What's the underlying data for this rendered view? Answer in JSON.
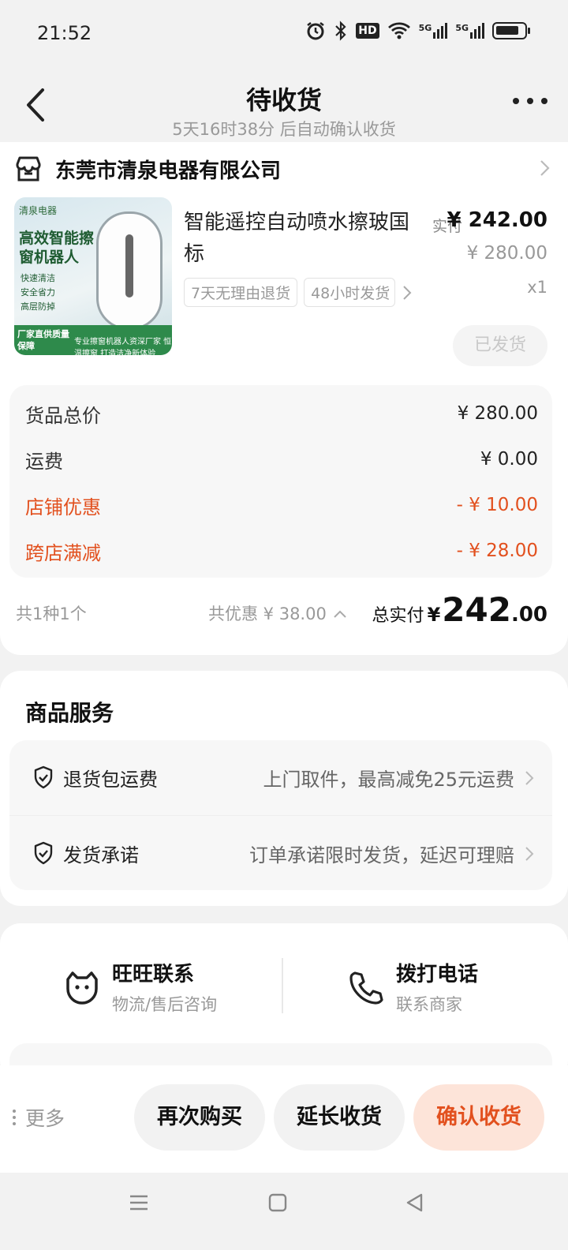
{
  "status_bar": {
    "time": "21:52",
    "hd_label": "HD",
    "net1": "5G",
    "net2": "5G"
  },
  "nav": {
    "title": "待收货",
    "subtitle": "5天16时38分 后自动确认收货"
  },
  "order": {
    "shop_name": "东莞市清泉电器有限公司",
    "product": {
      "thumb_brand": "清泉电器",
      "thumb_title": "高效智能擦窗机器人",
      "thumb_checks": [
        "快速清洁",
        "安全省力",
        "高层防掉"
      ],
      "thumb_badge": "厂家直供质量保障",
      "thumb_sub": "专业擦窗机器人资深厂家 恒温擦窗 打造洁净新体验",
      "title": "智能遥控自动喷水擦玻国标",
      "paid_label": "实付",
      "paid_price": "¥ 242.00",
      "original_price": "¥ 280.00",
      "quantity": "x1",
      "tags": [
        "7天无理由退货",
        "48小时发货"
      ],
      "status_button": "已发货"
    },
    "price_rows": [
      {
        "label": "货品总价",
        "value": "¥ 280.00"
      },
      {
        "label": "运费",
        "value": "¥ 0.00"
      },
      {
        "label": "店铺优惠",
        "value": "- ¥ 10.00"
      },
      {
        "label": "跨店满减",
        "value": "- ¥ 28.00"
      }
    ],
    "summary": {
      "count": "共1种1个",
      "discount": "共优惠 ¥ 38.00",
      "total_label": "总实付",
      "currency": "¥",
      "total_int": "242",
      "total_dec": ".00"
    }
  },
  "services": {
    "title": "商品服务",
    "items": [
      {
        "name": "退货包运费",
        "desc": "上门取件，最高减免25元运费"
      },
      {
        "name": "发货承诺",
        "desc": "订单承诺限时发货，延迟可理赔"
      }
    ]
  },
  "contact": {
    "wangwang": {
      "title": "旺旺联系",
      "sub": "物流/售后咨询"
    },
    "phone": {
      "title": "拨打电话",
      "sub": "联系商家"
    }
  },
  "actions": {
    "more": "更多",
    "buy_again": "再次购买",
    "extend": "延长收货",
    "confirm": "确认收货"
  },
  "colors": {
    "accent": "#e2501e",
    "accent_bg": "#fde4d9",
    "page_bg": "#f2f2f2"
  }
}
